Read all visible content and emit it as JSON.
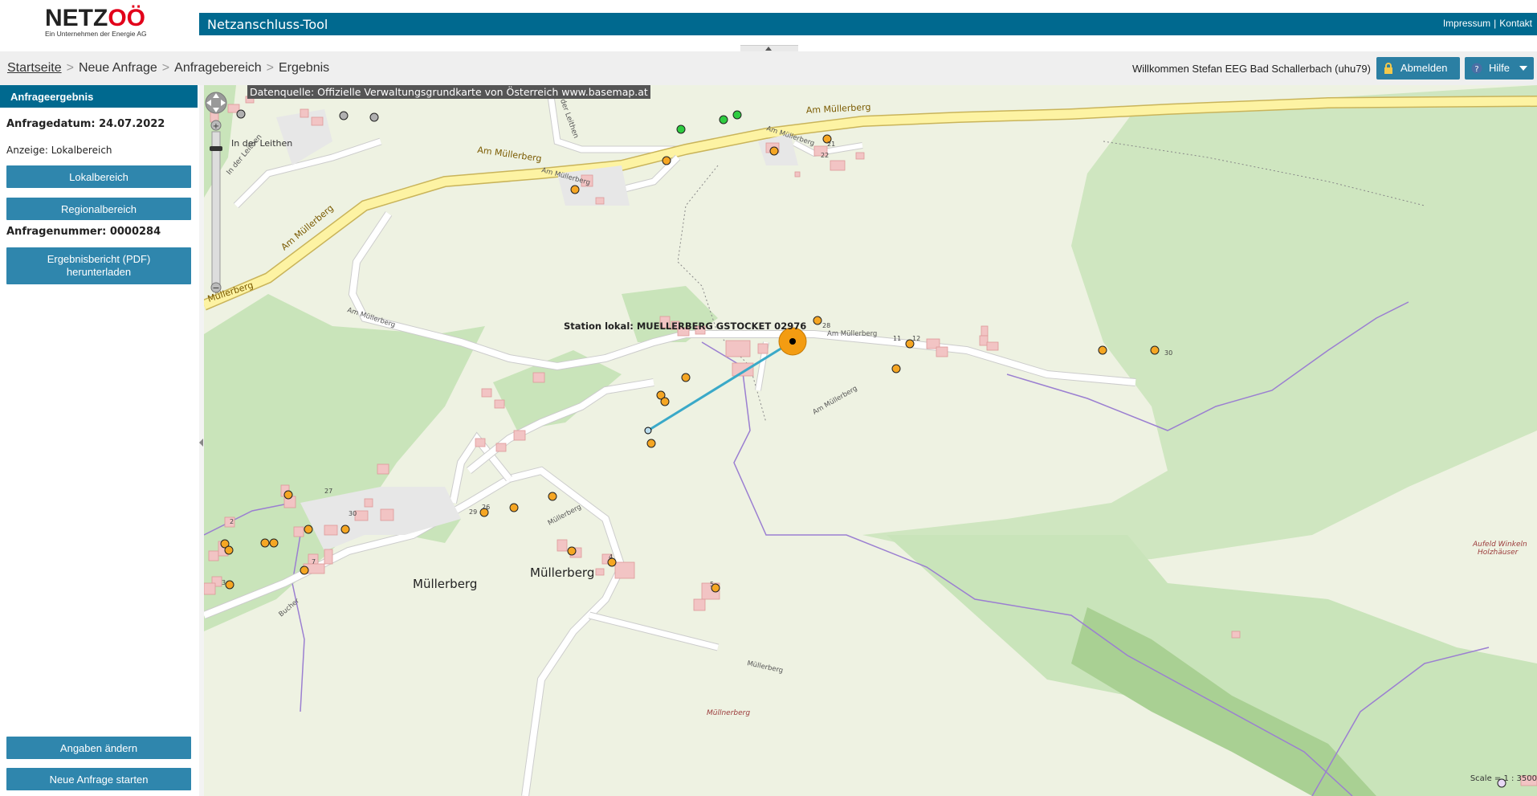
{
  "header": {
    "logo_text_a": "NETZ",
    "logo_text_b": "OÖ",
    "logo_tagline": "Ein Unternehmen der Energie AG",
    "app_title": "Netzanschluss-Tool",
    "impressum": "Impressum",
    "separator": "|",
    "kontakt": "Kontakt"
  },
  "breadcrumb": {
    "home": "Startseite",
    "arrow": ">",
    "step2": "Neue Anfrage",
    "step3": "Anfragebereich",
    "step4": "Ergebnis"
  },
  "user": {
    "welcome": "Willkommen Stefan EEG Bad Schallerbach (uhu79)",
    "logout": "Abmelden",
    "help": "Hilfe"
  },
  "sidebar": {
    "header": "Anfrageergebnis",
    "date": "Anfragedatum: 24.07.2022",
    "display": "Anzeige: Lokalbereich",
    "btn_local": "Lokalbereich",
    "btn_regional": "Regionalbereich",
    "request_number": "Anfragenummer: 0000284",
    "btn_report_line1": "Ergebnisbericht (PDF)",
    "btn_report_line2": "herunterladen",
    "btn_change": "Angaben ändern",
    "btn_new": "Neue Anfrage starten"
  },
  "map": {
    "datasource": "Datenquelle: Offizielle Verwaltungsgrundkarte von Österreich www.basemap.at",
    "station_label": "Station lokal: MUELLERBERG GSTOCKET 02976",
    "scale": "Scale = 1 : 3500",
    "labels": {
      "road_main_1": "Am  Müllerberg",
      "road_main_2": "Am Müllerberg",
      "road_main_3": "Am  Müllerberg",
      "road_main_4": "Müllerberg",
      "in_der_leithen": "In der Leithen",
      "in_der_leithen_road": "In der Leithen",
      "in_der_leithen_road2": "In der Leithen",
      "am_muellerberg_small1": "Am Müllerberg",
      "am_muellerberg_small2": "Am Müllerberg",
      "am_muellerberg_small3": "Am Müllerberg",
      "am_muellerberg_small4": "Am Müllerberg",
      "am_muellerberg_small5": "Am Müllerberg",
      "muellerberg_place1": "Müllerberg",
      "muellerberg_place2": "Müllerberg",
      "muellerberg_road": "Müllerberg",
      "muellerberg_road2": "Müllerberg",
      "muellnerberg": "Müllnerberg",
      "aufeld": "Aufeld Winkeln",
      "holzhaeuser": "Holzhäuser",
      "bucher": "Bucher"
    },
    "house_numbers": [
      "22",
      "21",
      "28",
      "11",
      "12",
      "30",
      "27",
      "26",
      "29",
      "30",
      "2",
      "3",
      "7",
      "4",
      "5"
    ],
    "colors": {
      "connection_line": "#3aa9c8",
      "station": "#f39c12",
      "point_orange": "#f5a623",
      "point_green": "#2ecc40",
      "point_grey": "#b0b0b0",
      "road_major": "#fdf3a3",
      "forest": "#c8e3b8",
      "building": "#f2c4c4",
      "boundary": "#9b7fd1"
    }
  }
}
